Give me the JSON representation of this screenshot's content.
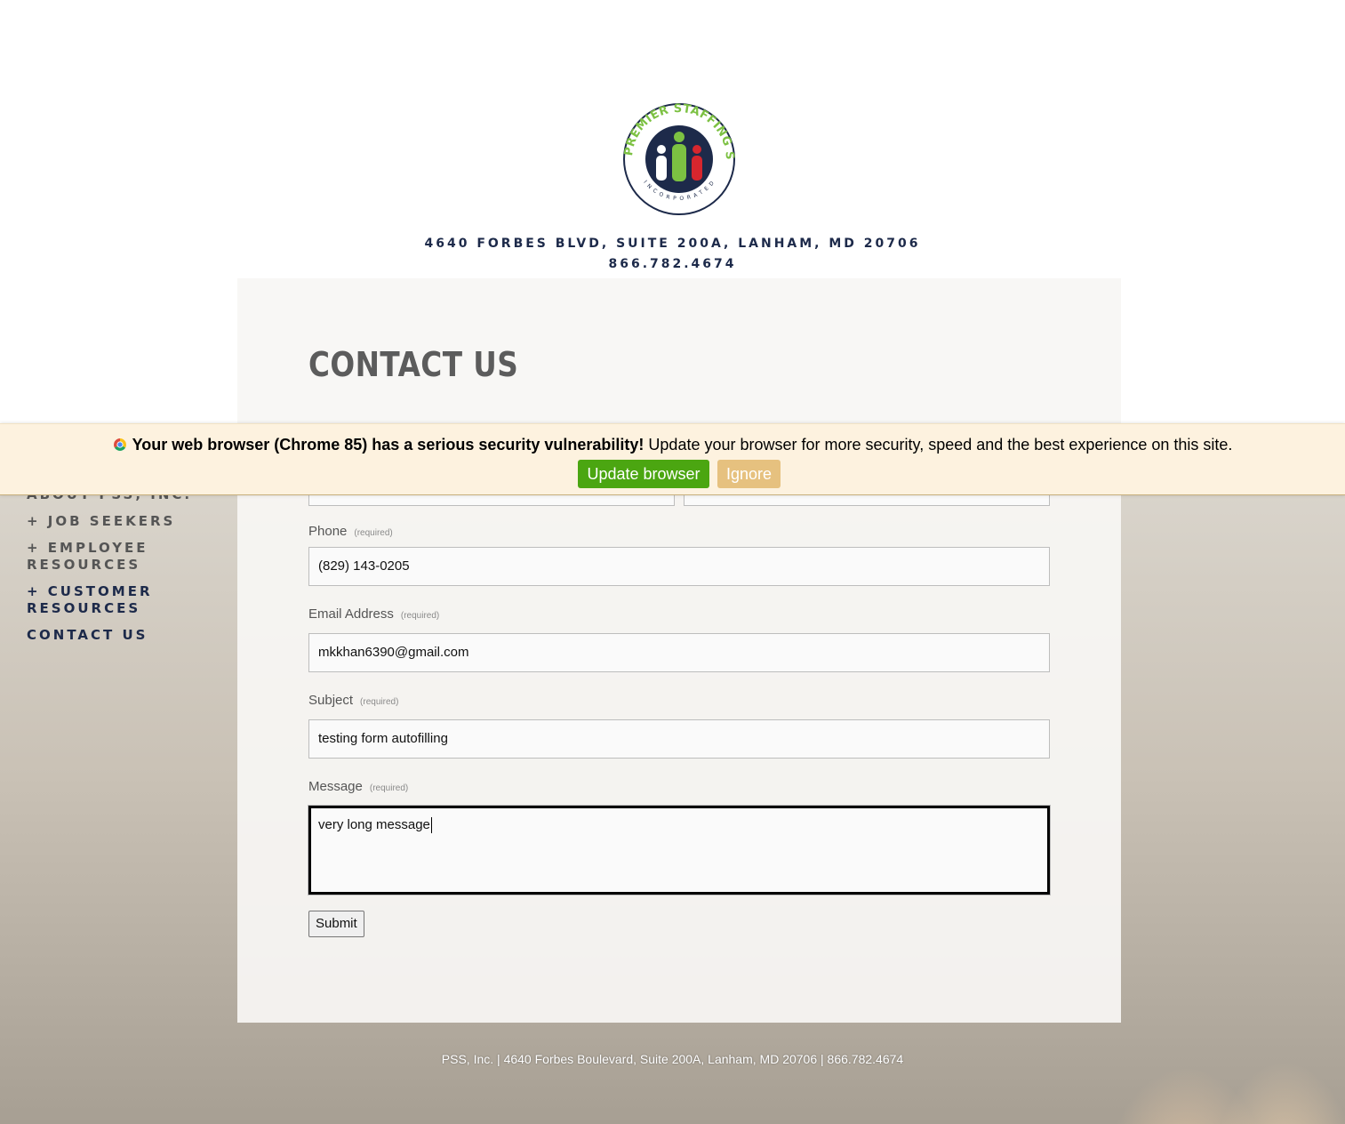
{
  "header": {
    "logo": {
      "top_text": "PREMIER STAFFING SOURCE",
      "bottom_text": "INCORPORATED",
      "colors": {
        "navy": "#1d2a4a",
        "green": "#7cc142",
        "red": "#d7262e"
      }
    },
    "address": "4640 FORBES BLVD, SUITE 200A, LANHAM, MD 20706",
    "phone": "866.782.4674"
  },
  "nav": {
    "items": [
      {
        "label": "ABOUT PSS, INC."
      },
      {
        "label": "+ JOB SEEKERS"
      },
      {
        "label_line1": "+ EMPLOYEE",
        "label_line2": "RESOURCES"
      },
      {
        "label_line1": "+ CUSTOMER",
        "label_line2": "RESOURCES"
      },
      {
        "label": "CONTACT US"
      }
    ]
  },
  "main": {
    "title": "CONTACT US"
  },
  "form": {
    "required_tag": "(required)",
    "phone": {
      "label": "Phone",
      "value": "(829) 143-0205"
    },
    "email": {
      "label": "Email Address",
      "value": "mkkhan6390@gmail.com"
    },
    "subject": {
      "label": "Subject",
      "value": "testing form autofilling"
    },
    "message": {
      "label": "Message",
      "value": "very long message"
    },
    "submit_label": "Submit"
  },
  "banner": {
    "bold_text": "Your web browser (Chrome 85) has a serious security vulnerability!",
    "text": "Update your browser for more security, speed and the best experience on this site.",
    "update_label": "Update browser",
    "ignore_label": "Ignore",
    "colors": {
      "background": "#fdf2df",
      "update": "#4ba611",
      "ignore": "#e6c17f"
    }
  },
  "footer": {
    "text": "PSS, Inc. | 4640 Forbes Boulevard, Suite 200A, Lanham, MD 20706 | 866.782.4674"
  }
}
